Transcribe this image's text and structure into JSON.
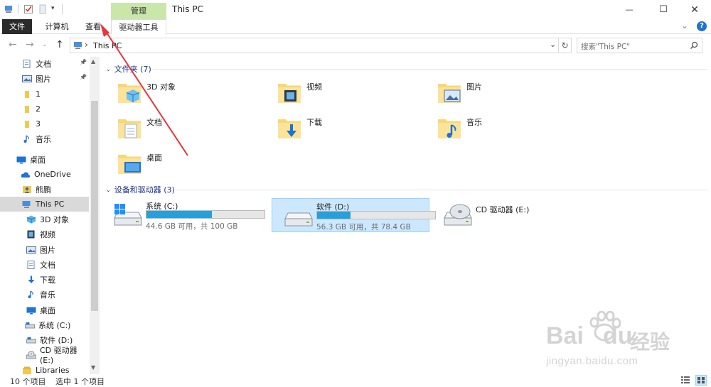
{
  "window": {
    "title": "This PC",
    "context_tab_group": "管理",
    "minimize_glyph": "—",
    "maximize_glyph": "☐",
    "close_glyph": "✕"
  },
  "ribbon": {
    "tabs": [
      {
        "label": "文件"
      },
      {
        "label": "计算机"
      },
      {
        "label": "查看"
      },
      {
        "label": "驱动器工具"
      }
    ],
    "expand_glyph": "⌄",
    "help_glyph": "?"
  },
  "address": {
    "path_separator": "›",
    "path": "This PC",
    "dropdown_glyph": "⌄",
    "refresh_glyph": "↻"
  },
  "search": {
    "placeholder": "搜索\"This PC\""
  },
  "sidebar": {
    "items": [
      {
        "label": "文档",
        "pinned": true,
        "icon": "document-icon"
      },
      {
        "label": "图片",
        "pinned": true,
        "icon": "picture-icon"
      },
      {
        "label": "1",
        "icon": "folder-icon"
      },
      {
        "label": "2",
        "icon": "folder-icon"
      },
      {
        "label": "3",
        "icon": "folder-icon"
      },
      {
        "label": "音乐",
        "icon": "music-icon"
      },
      {
        "label": "桌面",
        "icon": "desktop-icon"
      },
      {
        "label": "OneDrive",
        "icon": "cloud-icon"
      },
      {
        "label": "熊鹏",
        "icon": "user-icon"
      },
      {
        "label": "This PC",
        "icon": "computer-icon",
        "selected": true
      },
      {
        "label": "3D 对象",
        "icon": "3d-objects-icon"
      },
      {
        "label": "视频",
        "icon": "video-icon"
      },
      {
        "label": "图片",
        "icon": "picture-icon"
      },
      {
        "label": "文档",
        "icon": "document-icon"
      },
      {
        "label": "下载",
        "icon": "download-icon"
      },
      {
        "label": "音乐",
        "icon": "music-icon"
      },
      {
        "label": "桌面",
        "icon": "desktop-icon"
      },
      {
        "label": "系统 (C:)",
        "icon": "drive-icon"
      },
      {
        "label": "软件 (D:)",
        "icon": "drive-icon"
      },
      {
        "label": "CD 驱动器 (E:)",
        "icon": "cd-drive-icon"
      },
      {
        "label": "Libraries",
        "icon": "libraries-icon"
      }
    ]
  },
  "folders_group": {
    "header": "文件夹 (7)",
    "items": [
      {
        "label": "3D 对象",
        "icon": "3d-objects-folder-icon"
      },
      {
        "label": "视频",
        "icon": "video-folder-icon"
      },
      {
        "label": "图片",
        "icon": "picture-folder-icon"
      },
      {
        "label": "文档",
        "icon": "document-folder-icon"
      },
      {
        "label": "下载",
        "icon": "download-folder-icon"
      },
      {
        "label": "音乐",
        "icon": "music-folder-icon"
      },
      {
        "label": "桌面",
        "icon": "desktop-folder-icon"
      }
    ]
  },
  "drives_group": {
    "header": "设备和驱动器 (3)",
    "items": [
      {
        "label": "系统 (C:)",
        "info": "44.6 GB 可用，共 100 GB",
        "used_fraction": 0.554,
        "icon": "windows-drive-icon"
      },
      {
        "label": "软件 (D:)",
        "info": "56.3 GB 可用，共 78.4 GB",
        "used_fraction": 0.282,
        "icon": "drive-icon",
        "selected": true
      },
      {
        "label": "CD 驱动器 (E:)",
        "icon": "cd-drive-icon"
      }
    ]
  },
  "status": {
    "count": "10 个项目",
    "selection": "选中 1 个项目"
  },
  "watermark": {
    "brand": "Bai",
    "brand2": "du",
    "cn": "经验",
    "url": "jingyan.baidu.com"
  },
  "colors": {
    "accent": "#0078d7",
    "context_tab": "#c9e7a8",
    "selection": "#cce8ff",
    "drive_fill": "#26a0da",
    "annotation_arrow": "#e8353a"
  }
}
